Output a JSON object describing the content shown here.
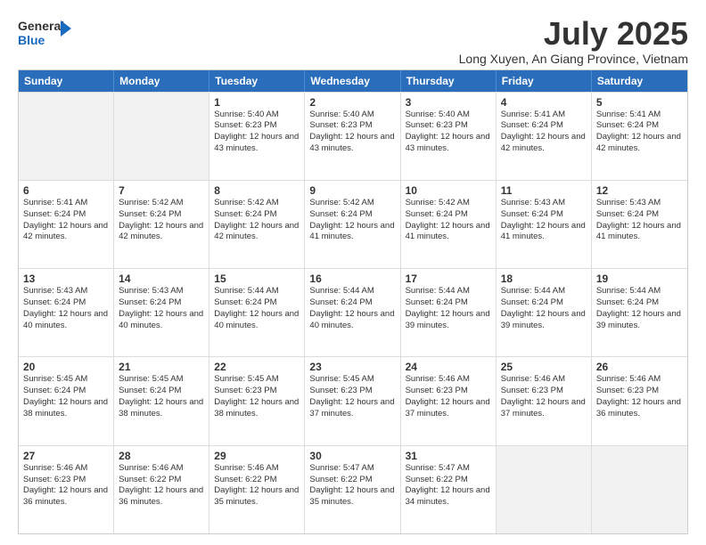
{
  "logo": {
    "line1": "General",
    "line2": "Blue"
  },
  "title": "July 2025",
  "subtitle": "Long Xuyen, An Giang Province, Vietnam",
  "header_days": [
    "Sunday",
    "Monday",
    "Tuesday",
    "Wednesday",
    "Thursday",
    "Friday",
    "Saturday"
  ],
  "weeks": [
    [
      {
        "day": "",
        "empty": true,
        "shaded": true
      },
      {
        "day": "",
        "empty": true,
        "shaded": true
      },
      {
        "day": "1",
        "sunrise": "5:40 AM",
        "sunset": "6:23 PM",
        "daylight": "12 hours and 43 minutes."
      },
      {
        "day": "2",
        "sunrise": "5:40 AM",
        "sunset": "6:23 PM",
        "daylight": "12 hours and 43 minutes."
      },
      {
        "day": "3",
        "sunrise": "5:40 AM",
        "sunset": "6:23 PM",
        "daylight": "12 hours and 43 minutes."
      },
      {
        "day": "4",
        "sunrise": "5:41 AM",
        "sunset": "6:24 PM",
        "daylight": "12 hours and 42 minutes."
      },
      {
        "day": "5",
        "sunrise": "5:41 AM",
        "sunset": "6:24 PM",
        "daylight": "12 hours and 42 minutes."
      }
    ],
    [
      {
        "day": "6",
        "sunrise": "5:41 AM",
        "sunset": "6:24 PM",
        "daylight": "12 hours and 42 minutes."
      },
      {
        "day": "7",
        "sunrise": "5:42 AM",
        "sunset": "6:24 PM",
        "daylight": "12 hours and 42 minutes."
      },
      {
        "day": "8",
        "sunrise": "5:42 AM",
        "sunset": "6:24 PM",
        "daylight": "12 hours and 42 minutes."
      },
      {
        "day": "9",
        "sunrise": "5:42 AM",
        "sunset": "6:24 PM",
        "daylight": "12 hours and 41 minutes."
      },
      {
        "day": "10",
        "sunrise": "5:42 AM",
        "sunset": "6:24 PM",
        "daylight": "12 hours and 41 minutes."
      },
      {
        "day": "11",
        "sunrise": "5:43 AM",
        "sunset": "6:24 PM",
        "daylight": "12 hours and 41 minutes."
      },
      {
        "day": "12",
        "sunrise": "5:43 AM",
        "sunset": "6:24 PM",
        "daylight": "12 hours and 41 minutes."
      }
    ],
    [
      {
        "day": "13",
        "sunrise": "5:43 AM",
        "sunset": "6:24 PM",
        "daylight": "12 hours and 40 minutes."
      },
      {
        "day": "14",
        "sunrise": "5:43 AM",
        "sunset": "6:24 PM",
        "daylight": "12 hours and 40 minutes."
      },
      {
        "day": "15",
        "sunrise": "5:44 AM",
        "sunset": "6:24 PM",
        "daylight": "12 hours and 40 minutes."
      },
      {
        "day": "16",
        "sunrise": "5:44 AM",
        "sunset": "6:24 PM",
        "daylight": "12 hours and 40 minutes."
      },
      {
        "day": "17",
        "sunrise": "5:44 AM",
        "sunset": "6:24 PM",
        "daylight": "12 hours and 39 minutes."
      },
      {
        "day": "18",
        "sunrise": "5:44 AM",
        "sunset": "6:24 PM",
        "daylight": "12 hours and 39 minutes."
      },
      {
        "day": "19",
        "sunrise": "5:44 AM",
        "sunset": "6:24 PM",
        "daylight": "12 hours and 39 minutes."
      }
    ],
    [
      {
        "day": "20",
        "sunrise": "5:45 AM",
        "sunset": "6:24 PM",
        "daylight": "12 hours and 38 minutes."
      },
      {
        "day": "21",
        "sunrise": "5:45 AM",
        "sunset": "6:24 PM",
        "daylight": "12 hours and 38 minutes."
      },
      {
        "day": "22",
        "sunrise": "5:45 AM",
        "sunset": "6:23 PM",
        "daylight": "12 hours and 38 minutes."
      },
      {
        "day": "23",
        "sunrise": "5:45 AM",
        "sunset": "6:23 PM",
        "daylight": "12 hours and 37 minutes."
      },
      {
        "day": "24",
        "sunrise": "5:46 AM",
        "sunset": "6:23 PM",
        "daylight": "12 hours and 37 minutes."
      },
      {
        "day": "25",
        "sunrise": "5:46 AM",
        "sunset": "6:23 PM",
        "daylight": "12 hours and 37 minutes."
      },
      {
        "day": "26",
        "sunrise": "5:46 AM",
        "sunset": "6:23 PM",
        "daylight": "12 hours and 36 minutes."
      }
    ],
    [
      {
        "day": "27",
        "sunrise": "5:46 AM",
        "sunset": "6:23 PM",
        "daylight": "12 hours and 36 minutes."
      },
      {
        "day": "28",
        "sunrise": "5:46 AM",
        "sunset": "6:22 PM",
        "daylight": "12 hours and 36 minutes."
      },
      {
        "day": "29",
        "sunrise": "5:46 AM",
        "sunset": "6:22 PM",
        "daylight": "12 hours and 35 minutes."
      },
      {
        "day": "30",
        "sunrise": "5:47 AM",
        "sunset": "6:22 PM",
        "daylight": "12 hours and 35 minutes."
      },
      {
        "day": "31",
        "sunrise": "5:47 AM",
        "sunset": "6:22 PM",
        "daylight": "12 hours and 34 minutes."
      },
      {
        "day": "",
        "empty": true,
        "shaded": true
      },
      {
        "day": "",
        "empty": true,
        "shaded": true
      }
    ]
  ]
}
